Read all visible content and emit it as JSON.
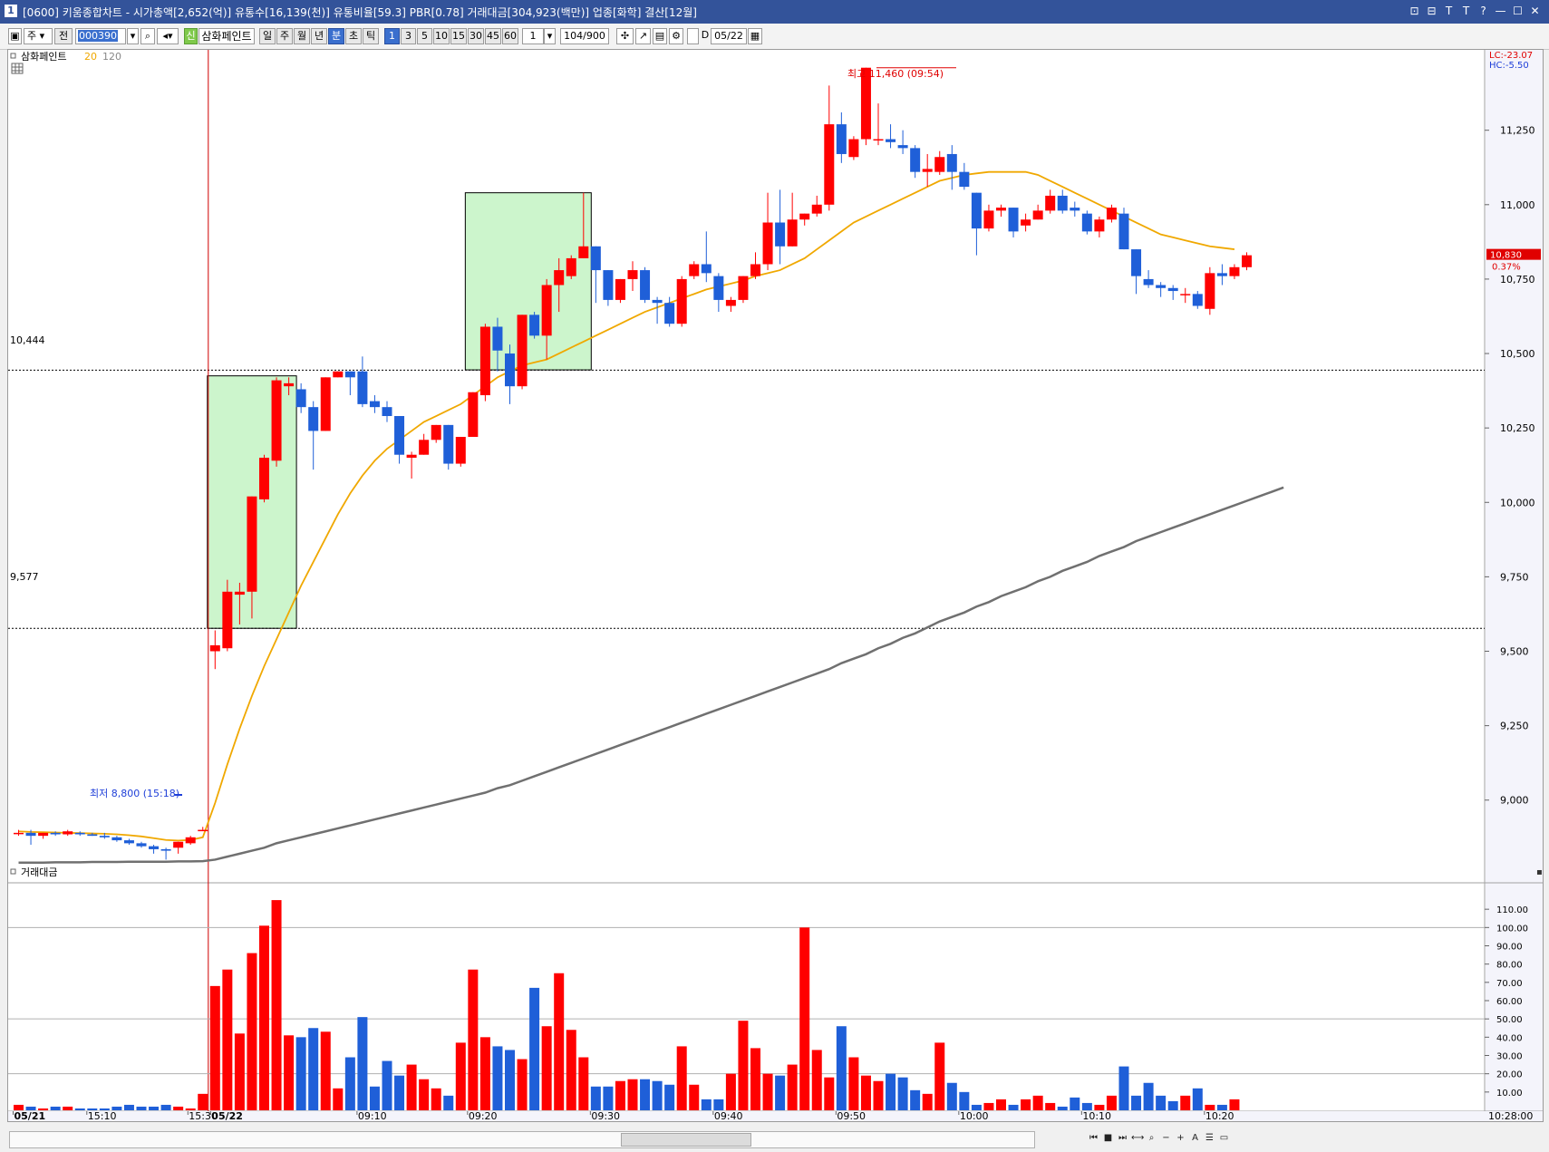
{
  "window": {
    "number": "1",
    "title": "[0600] 키움종합차트 - 시가총액[2,652(억)] 유통수[16,139(천)] 유통비율[59.3] PBR[0.78] 거래대금[304,923(백만)] 업종[화학] 결산[12월]",
    "controls": [
      "⊡",
      "⊟",
      "T",
      "T",
      "?",
      "—",
      "☐",
      "✕"
    ]
  },
  "toolbar": {
    "stock_type": "주",
    "all_button": "전",
    "stock_code": "000390",
    "new_badge": "신",
    "stock_name": "삼화페인트",
    "periods": [
      "일",
      "주",
      "월",
      "년",
      "분",
      "초",
      "틱"
    ],
    "selected_period": "분",
    "intervals": [
      "1",
      "3",
      "5",
      "10",
      "15",
      "30",
      "45",
      "60"
    ],
    "selected_interval": "1",
    "custom_interval": "1",
    "count_display": "104",
    "count_total": "/900",
    "date_check_label": "D",
    "date_value": "05/22"
  },
  "price_panel": {
    "legend_name": "삼화페인트",
    "ma_short": "20",
    "ma_long": "120",
    "lc": "LC:-23.07",
    "hc": "HC:-5.50",
    "high_annotation": "최고 11,460 (09:54)",
    "low_annotation": "최저 8,800 (15:18)",
    "ref_high": "10,444",
    "ref_low": "9,577",
    "current_price": "10,830",
    "current_change": "0.37%",
    "y_ticks": [
      "11,250",
      "11,000",
      "10,750",
      "10,500",
      "10,250",
      "10,000",
      "9,750",
      "9,500",
      "9,250",
      "9,000"
    ]
  },
  "volume_panel": {
    "legend_name": "거래대금",
    "y_ticks": [
      "110.00",
      "100.00",
      "90.00",
      "80.00",
      "70.00",
      "60.00",
      "50.00",
      "40.00",
      "30.00",
      "20.00",
      "10.00"
    ]
  },
  "x_axis": {
    "labels": [
      "05/21",
      "15:10",
      "15:30",
      "05/22",
      "09:10",
      "09:20",
      "09:30",
      "09:40",
      "09:50",
      "10:00",
      "10:10",
      "10:20"
    ],
    "right_label": "10:28:00"
  },
  "colors": {
    "up": "#ff0000",
    "down": "#1f5fd8",
    "ma20": "#f0a800",
    "ma120": "#707070",
    "highlight": "#ccf5cc",
    "title_bar": "#33539a"
  },
  "chart_data": {
    "type": "candlestick",
    "symbol": "삼화페인트",
    "y_range": [
      8780,
      11520
    ],
    "ma_lines": [
      {
        "name": "20"
      },
      {
        "name": "120"
      }
    ],
    "candles": [
      {
        "o": 8890,
        "h": 8900,
        "l": 8880,
        "c": 8890
      },
      {
        "o": 8890,
        "h": 8900,
        "l": 8850,
        "c": 8880
      },
      {
        "o": 8880,
        "h": 8890,
        "l": 8870,
        "c": 8890
      },
      {
        "o": 8890,
        "h": 8895,
        "l": 8880,
        "c": 8885
      },
      {
        "o": 8885,
        "h": 8900,
        "l": 8880,
        "c": 8895
      },
      {
        "o": 8890,
        "h": 8895,
        "l": 8880,
        "c": 8885
      },
      {
        "o": 8885,
        "h": 8890,
        "l": 8880,
        "c": 8880
      },
      {
        "o": 8880,
        "h": 8890,
        "l": 8870,
        "c": 8875
      },
      {
        "o": 8875,
        "h": 8880,
        "l": 8860,
        "c": 8865
      },
      {
        "o": 8865,
        "h": 8870,
        "l": 8850,
        "c": 8855
      },
      {
        "o": 8855,
        "h": 8860,
        "l": 8840,
        "c": 8845
      },
      {
        "o": 8845,
        "h": 8850,
        "l": 8820,
        "c": 8835
      },
      {
        "o": 8835,
        "h": 8840,
        "l": 8800,
        "c": 8830
      },
      {
        "o": 8840,
        "h": 8860,
        "l": 8820,
        "c": 8860
      },
      {
        "o": 8855,
        "h": 8880,
        "l": 8850,
        "c": 8875
      },
      {
        "o": 8900,
        "h": 8910,
        "l": 8900,
        "c": 8900
      },
      {
        "o": 9500,
        "h": 9570,
        "l": 9440,
        "c": 9520
      },
      {
        "o": 9510,
        "h": 9740,
        "l": 9500,
        "c": 9700
      },
      {
        "o": 9690,
        "h": 9730,
        "l": 9590,
        "c": 9700
      },
      {
        "o": 9700,
        "h": 10020,
        "l": 9610,
        "c": 10020
      },
      {
        "o": 10010,
        "h": 10160,
        "l": 10000,
        "c": 10150
      },
      {
        "o": 10140,
        "h": 10420,
        "l": 10120,
        "c": 10410
      },
      {
        "o": 10390,
        "h": 10420,
        "l": 10360,
        "c": 10400
      },
      {
        "o": 10380,
        "h": 10400,
        "l": 10300,
        "c": 10320
      },
      {
        "o": 10320,
        "h": 10340,
        "l": 10110,
        "c": 10240
      },
      {
        "o": 10240,
        "h": 10420,
        "l": 10240,
        "c": 10420
      },
      {
        "o": 10420,
        "h": 10440,
        "l": 10420,
        "c": 10440
      },
      {
        "o": 10440,
        "h": 10440,
        "l": 10360,
        "c": 10420
      },
      {
        "o": 10440,
        "h": 10490,
        "l": 10320,
        "c": 10330
      },
      {
        "o": 10340,
        "h": 10360,
        "l": 10300,
        "c": 10320
      },
      {
        "o": 10320,
        "h": 10340,
        "l": 10270,
        "c": 10290
      },
      {
        "o": 10290,
        "h": 10290,
        "l": 10130,
        "c": 10160
      },
      {
        "o": 10150,
        "h": 10170,
        "l": 10080,
        "c": 10160
      },
      {
        "o": 10160,
        "h": 10230,
        "l": 10160,
        "c": 10210
      },
      {
        "o": 10210,
        "h": 10260,
        "l": 10200,
        "c": 10260
      },
      {
        "o": 10260,
        "h": 10260,
        "l": 10110,
        "c": 10130
      },
      {
        "o": 10130,
        "h": 10220,
        "l": 10120,
        "c": 10220
      },
      {
        "o": 10220,
        "h": 10370,
        "l": 10220,
        "c": 10370
      },
      {
        "o": 10360,
        "h": 10600,
        "l": 10340,
        "c": 10590
      },
      {
        "o": 10590,
        "h": 10620,
        "l": 10440,
        "c": 10510
      },
      {
        "o": 10500,
        "h": 10530,
        "l": 10330,
        "c": 10390
      },
      {
        "o": 10390,
        "h": 10630,
        "l": 10380,
        "c": 10630
      },
      {
        "o": 10630,
        "h": 10640,
        "l": 10550,
        "c": 10560
      },
      {
        "o": 10560,
        "h": 10750,
        "l": 10480,
        "c": 10730
      },
      {
        "o": 10730,
        "h": 10820,
        "l": 10640,
        "c": 10780
      },
      {
        "o": 10760,
        "h": 10830,
        "l": 10750,
        "c": 10820
      },
      {
        "o": 10820,
        "h": 11040,
        "l": 10820,
        "c": 10860
      },
      {
        "o": 10860,
        "h": 10860,
        "l": 10670,
        "c": 10780
      },
      {
        "o": 10780,
        "h": 10780,
        "l": 10660,
        "c": 10680
      },
      {
        "o": 10680,
        "h": 10750,
        "l": 10670,
        "c": 10750
      },
      {
        "o": 10750,
        "h": 10810,
        "l": 10710,
        "c": 10780
      },
      {
        "o": 10780,
        "h": 10790,
        "l": 10670,
        "c": 10680
      },
      {
        "o": 10680,
        "h": 10690,
        "l": 10600,
        "c": 10670
      },
      {
        "o": 10670,
        "h": 10690,
        "l": 10590,
        "c": 10600
      },
      {
        "o": 10600,
        "h": 10760,
        "l": 10590,
        "c": 10750
      },
      {
        "o": 10760,
        "h": 10810,
        "l": 10750,
        "c": 10800
      },
      {
        "o": 10800,
        "h": 10910,
        "l": 10740,
        "c": 10770
      },
      {
        "o": 10760,
        "h": 10770,
        "l": 10640,
        "c": 10680
      },
      {
        "o": 10660,
        "h": 10690,
        "l": 10640,
        "c": 10680
      },
      {
        "o": 10680,
        "h": 10760,
        "l": 10670,
        "c": 10760
      },
      {
        "o": 10760,
        "h": 10840,
        "l": 10750,
        "c": 10800
      },
      {
        "o": 10800,
        "h": 11040,
        "l": 10780,
        "c": 10940
      },
      {
        "o": 10940,
        "h": 11050,
        "l": 10800,
        "c": 10860
      },
      {
        "o": 10860,
        "h": 11040,
        "l": 10860,
        "c": 10950
      },
      {
        "o": 10950,
        "h": 10970,
        "l": 10930,
        "c": 10970
      },
      {
        "o": 10970,
        "h": 11030,
        "l": 10960,
        "c": 11000
      },
      {
        "o": 11000,
        "h": 11400,
        "l": 10980,
        "c": 11270
      },
      {
        "o": 11270,
        "h": 11310,
        "l": 11140,
        "c": 11170
      },
      {
        "o": 11160,
        "h": 11230,
        "l": 11150,
        "c": 11220
      },
      {
        "o": 11220,
        "h": 11460,
        "l": 11200,
        "c": 11460
      },
      {
        "o": 11220,
        "h": 11340,
        "l": 11200,
        "c": 11220
      },
      {
        "o": 11220,
        "h": 11270,
        "l": 11190,
        "c": 11210
      },
      {
        "o": 11200,
        "h": 11250,
        "l": 11170,
        "c": 11190
      },
      {
        "o": 11190,
        "h": 11200,
        "l": 11090,
        "c": 11110
      },
      {
        "o": 11110,
        "h": 11170,
        "l": 11060,
        "c": 11120
      },
      {
        "o": 11110,
        "h": 11180,
        "l": 11100,
        "c": 11160
      },
      {
        "o": 11170,
        "h": 11200,
        "l": 11050,
        "c": 11110
      },
      {
        "o": 11110,
        "h": 11140,
        "l": 11050,
        "c": 11060
      },
      {
        "o": 11040,
        "h": 11040,
        "l": 10830,
        "c": 10920
      },
      {
        "o": 10920,
        "h": 11000,
        "l": 10910,
        "c": 10980
      },
      {
        "o": 10980,
        "h": 11000,
        "l": 10960,
        "c": 10990
      },
      {
        "o": 10990,
        "h": 10990,
        "l": 10890,
        "c": 10910
      },
      {
        "o": 10930,
        "h": 10970,
        "l": 10910,
        "c": 10950
      },
      {
        "o": 10950,
        "h": 11000,
        "l": 10950,
        "c": 10980
      },
      {
        "o": 10980,
        "h": 11050,
        "l": 10970,
        "c": 11030
      },
      {
        "o": 11030,
        "h": 11050,
        "l": 10970,
        "c": 10980
      },
      {
        "o": 10990,
        "h": 11010,
        "l": 10960,
        "c": 10980
      },
      {
        "o": 10970,
        "h": 10980,
        "l": 10900,
        "c": 10910
      },
      {
        "o": 10910,
        "h": 10960,
        "l": 10890,
        "c": 10950
      },
      {
        "o": 10950,
        "h": 11000,
        "l": 10940,
        "c": 10990
      },
      {
        "o": 10970,
        "h": 10990,
        "l": 10850,
        "c": 10850
      },
      {
        "o": 10850,
        "h": 10850,
        "l": 10700,
        "c": 10760
      },
      {
        "o": 10750,
        "h": 10780,
        "l": 10720,
        "c": 10730
      },
      {
        "o": 10730,
        "h": 10740,
        "l": 10690,
        "c": 10720
      },
      {
        "o": 10720,
        "h": 10730,
        "l": 10680,
        "c": 10710
      },
      {
        "o": 10700,
        "h": 10720,
        "l": 10670,
        "c": 10700
      },
      {
        "o": 10700,
        "h": 10710,
        "l": 10650,
        "c": 10660
      },
      {
        "o": 10650,
        "h": 10790,
        "l": 10630,
        "c": 10770
      },
      {
        "o": 10770,
        "h": 10800,
        "l": 10730,
        "c": 10760
      },
      {
        "o": 10760,
        "h": 10800,
        "l": 10750,
        "c": 10790
      },
      {
        "o": 10790,
        "h": 10840,
        "l": 10780,
        "c": 10830
      }
    ],
    "ma20": [
      8895,
      8893,
      8892,
      8891,
      8890,
      8889,
      8888,
      8887,
      8885,
      8882,
      8878,
      8872,
      8866,
      8864,
      8866,
      8875,
      8990,
      9120,
      9240,
      9350,
      9450,
      9540,
      9630,
      9720,
      9800,
      9880,
      9960,
      10030,
      10090,
      10140,
      10180,
      10210,
      10240,
      10270,
      10290,
      10310,
      10330,
      10360,
      10390,
      10420,
      10440,
      10460,
      10470,
      10480,
      10500,
      10520,
      10540,
      10560,
      10580,
      10600,
      10620,
      10640,
      10655,
      10670,
      10685,
      10700,
      10715,
      10725,
      10735,
      10745,
      10760,
      10770,
      10780,
      10800,
      10820,
      10850,
      10880,
      10910,
      10940,
      10960,
      10980,
      11000,
      11020,
      11040,
      11060,
      11080,
      11090,
      11100,
      11105,
      11110,
      11110,
      11110,
      11110,
      11100,
      11080,
      11060,
      11040,
      11020,
      11000,
      10980,
      10960,
      10940,
      10920,
      10900,
      10890,
      10880,
      10870,
      10860,
      10855,
      10850
    ],
    "ma120": [
      8790,
      8790,
      8790,
      8791,
      8791,
      8791,
      8792,
      8792,
      8792,
      8793,
      8793,
      8793,
      8793,
      8794,
      8794,
      8795,
      8800,
      8810,
      8820,
      8830,
      8840,
      8855,
      8865,
      8875,
      8885,
      8895,
      8905,
      8915,
      8925,
      8935,
      8945,
      8955,
      8965,
      8975,
      8985,
      8995,
      9005,
      9015,
      9025,
      9040,
      9050,
      9065,
      9080,
      9095,
      9110,
      9125,
      9140,
      9155,
      9170,
      9185,
      9200,
      9215,
      9230,
      9245,
      9260,
      9275,
      9290,
      9305,
      9320,
      9335,
      9350,
      9365,
      9380,
      9395,
      9410,
      9425,
      9440,
      9460,
      9475,
      9490,
      9510,
      9525,
      9545,
      9560,
      9580,
      9600,
      9615,
      9630,
      9650,
      9665,
      9685,
      9700,
      9715,
      9735,
      9750,
      9770,
      9785,
      9800,
      9820,
      9835,
      9850,
      9870,
      9885,
      9900,
      9915,
      9930,
      9945,
      9960,
      9975,
      9990,
      10005,
      10020,
      10035,
      10050
    ],
    "volume": [
      3,
      2,
      1,
      2,
      2,
      1,
      1,
      1,
      2,
      3,
      2,
      2,
      3,
      2,
      1,
      9,
      68,
      77,
      42,
      86,
      101,
      115,
      41,
      40,
      45,
      43,
      12,
      29,
      51,
      13,
      27,
      19,
      25,
      17,
      12,
      8,
      37,
      77,
      40,
      35,
      33,
      28,
      67,
      46,
      75,
      44,
      29,
      13,
      13,
      16,
      17,
      17,
      16,
      14,
      35,
      14,
      6,
      6,
      20,
      49,
      34,
      20,
      19,
      25,
      100,
      33,
      18,
      46,
      29,
      19,
      16,
      20,
      18,
      11,
      9,
      37,
      15,
      10,
      3,
      4,
      6,
      3,
      6,
      8,
      4,
      2,
      7,
      4,
      3,
      8,
      24,
      8,
      15,
      8,
      5,
      8,
      12,
      3,
      3,
      6
    ],
    "ref_lines": [
      10444,
      9577
    ],
    "highlight_boxes": [
      {
        "from": 16,
        "to": 22,
        "low": 9577,
        "high": 10425
      },
      {
        "from": 37,
        "to": 46,
        "low": 10445,
        "high": 11040
      }
    ]
  }
}
